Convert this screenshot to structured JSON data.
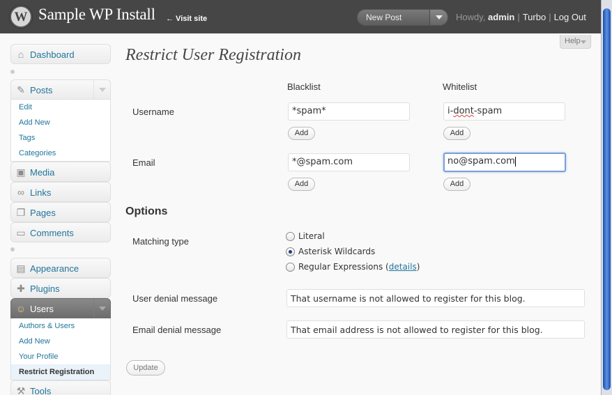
{
  "header": {
    "site_title": "Sample WP Install",
    "visit_site": "← Visit site",
    "favorite_action": "New Post",
    "howdy": "Howdy,",
    "username": "admin",
    "turbo": "Turbo",
    "logout": "Log Out"
  },
  "help": "Help",
  "menu": {
    "dashboard": "Dashboard",
    "posts": "Posts",
    "posts_sub": [
      "Edit",
      "Add New",
      "Tags",
      "Categories"
    ],
    "media": "Media",
    "links": "Links",
    "pages": "Pages",
    "comments": "Comments",
    "appearance": "Appearance",
    "plugins": "Plugins",
    "users": "Users",
    "users_sub": [
      "Authors & Users",
      "Add New",
      "Your Profile",
      "Restrict Registration"
    ],
    "tools": "Tools"
  },
  "page": {
    "title": "Restrict User Registration",
    "blacklist_header": "Blacklist",
    "whitelist_header": "Whitelist",
    "username_label": "Username",
    "email_label": "Email",
    "username_blacklist": "*spam*",
    "username_whitelist_pre": "i-",
    "username_whitelist_misspelled": "dont",
    "username_whitelist_post": "-spam",
    "email_blacklist": "*@spam.com",
    "email_whitelist": "no@spam.com",
    "add_label": "Add",
    "options_heading": "Options",
    "matching_type_label": "Matching type",
    "matching_options": [
      "Literal",
      "Asterisk Wildcards",
      "Regular Expressions ("
    ],
    "details_link": "details",
    "close_paren": ")",
    "selected_matching": "Asterisk Wildcards",
    "user_denial_label": "User denial message",
    "user_denial_value": "That username is not allowed to register for this blog.",
    "email_denial_label": "Email denial message",
    "email_denial_value": "That email address is not allowed to register for this blog.",
    "update_label": "Update"
  }
}
